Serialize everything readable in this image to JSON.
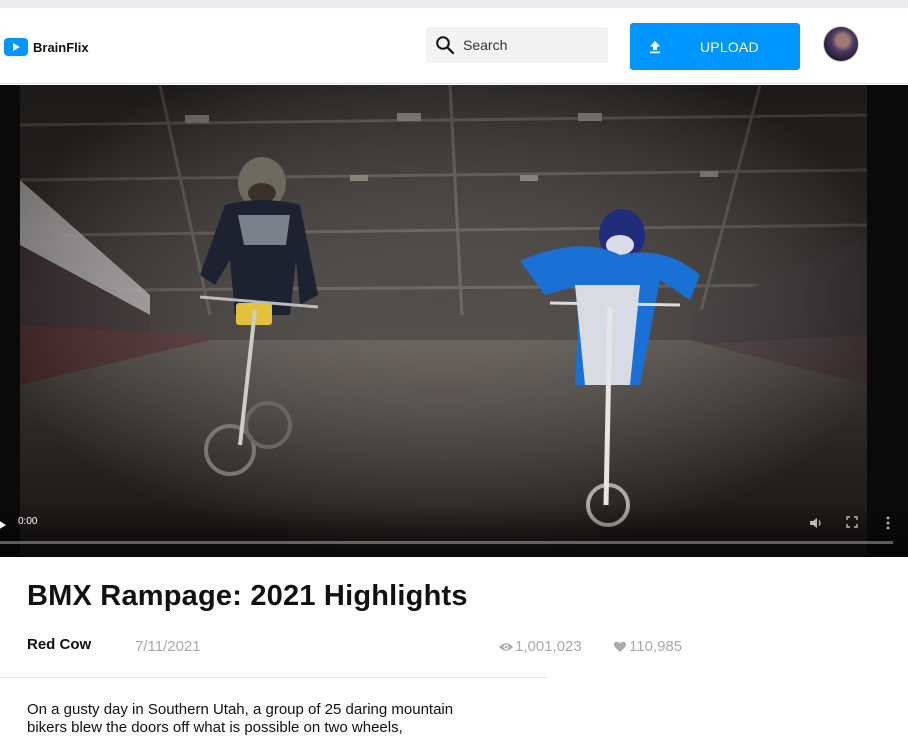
{
  "header": {
    "brand": "BrainFlix",
    "search_placeholder": "Search",
    "upload_label": "UPLOAD"
  },
  "player": {
    "current_time": "0:00",
    "progress": 0
  },
  "video": {
    "title": "BMX Rampage: 2021 Highlights",
    "channel": "Red Cow",
    "date": "7/11/2021",
    "views": "1,001,023",
    "likes": "110,985",
    "description": "On a gusty day in Southern Utah, a group of 25 daring mountain bikers blew the doors off what is possible on two wheels,"
  },
  "colors": {
    "accent": "#0095ff",
    "muted_text": "#aaaaaa"
  },
  "icons": {
    "brand": "play-logo-icon",
    "search": "search-icon",
    "upload": "upload-icon",
    "views": "eye-icon",
    "likes": "heart-icon"
  }
}
